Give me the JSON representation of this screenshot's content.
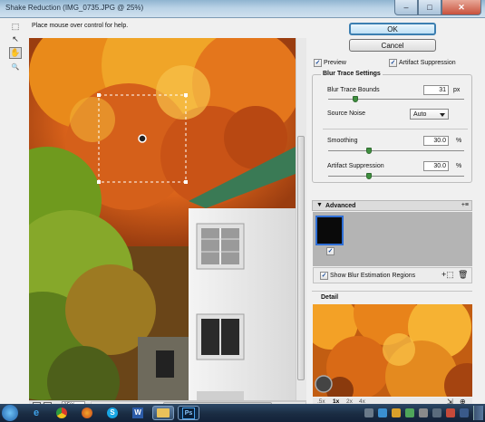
{
  "window": {
    "title": "Shake Reduction (IMG_0735.JPG @ 25%)",
    "min_glyph": "–",
    "max_glyph": "□",
    "close_glyph": "✕"
  },
  "tools": [
    {
      "name": "marquee-tool-icon",
      "glyph": "⬚"
    },
    {
      "name": "blur-estimation-tool-icon",
      "glyph": "↖"
    },
    {
      "name": "hand-tool-icon",
      "glyph": "✋"
    },
    {
      "name": "zoom-tool-icon",
      "glyph": "🔍"
    }
  ],
  "help_text": "Place mouse over control for help.",
  "buttons": {
    "ok": "OK",
    "cancel": "Cancel"
  },
  "options": {
    "preview_label": "Preview",
    "preview_checked": true,
    "artifact_label": "Artifact Suppression",
    "artifact_checked": true
  },
  "blur_trace": {
    "title": "Blur Trace Settings",
    "bounds_label": "Blur Trace Bounds",
    "bounds_value": "31",
    "bounds_unit": "px",
    "bounds_level": 0.2,
    "noise_label": "Source Noise",
    "noise_value": "Auto",
    "smoothing_label": "Smoothing",
    "smoothing_value": "30.0",
    "smoothing_unit": "%",
    "smoothing_level": 0.3,
    "artifact_label": "Artifact Suppression",
    "artifact_value": "30.0",
    "artifact_unit": "%",
    "artifact_level": 0.3
  },
  "advanced": {
    "title": "Advanced",
    "show_regions_label": "Show Blur Estimation Regions",
    "show_regions_checked": true
  },
  "detail": {
    "title": "Detail",
    "zoom_levels": [
      ".5x",
      "1x",
      "2x",
      "4x"
    ],
    "active_zoom": "1x"
  },
  "status": {
    "zoom": "25%"
  },
  "colors": {
    "titlebar": "#b9d2e6",
    "dialog_bg": "#f0f0f0",
    "slider_knob": "#3f8f3f",
    "taskbar": "#1a2c42",
    "selection_blue": "#2f6fd6"
  },
  "taskbar": {
    "apps": [
      "start-orb-icon",
      "ie-icon",
      "chrome-icon",
      "firefox-icon",
      "skype-icon",
      "word-icon",
      "explorer-icon",
      "photoshop-icon"
    ],
    "active_app_glyph": "Ps",
    "word_glyph": "W",
    "skype_glyph": "S"
  }
}
